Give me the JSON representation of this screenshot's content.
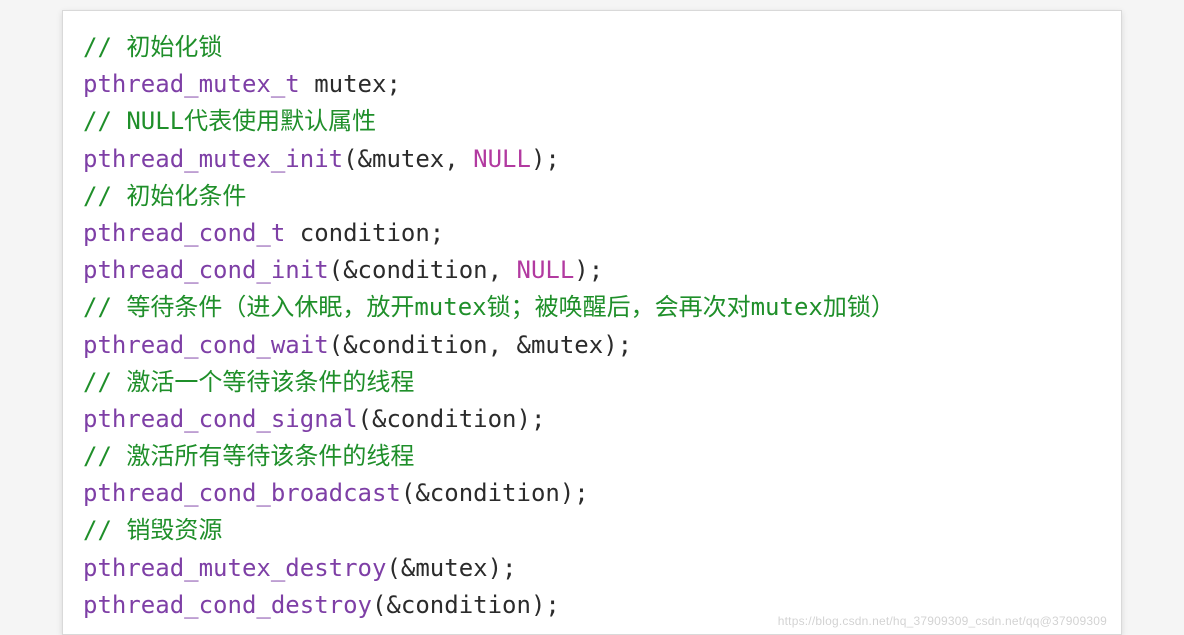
{
  "watermark": "https://blog.csdn.net/hq_37909309_csdn.net/qq@37909309",
  "code": {
    "lines": [
      {
        "tokens": [
          {
            "c": "tok-comment",
            "t": "// 初始化锁"
          }
        ]
      },
      {
        "tokens": [
          {
            "c": "tok-type",
            "t": "pthread_mutex_t"
          },
          {
            "c": "tok-ident",
            "t": " mutex"
          },
          {
            "c": "tok-punct",
            "t": ";"
          }
        ]
      },
      {
        "tokens": [
          {
            "c": "tok-comment",
            "t": "// NULL代表使用默认属性"
          }
        ]
      },
      {
        "tokens": [
          {
            "c": "tok-func",
            "t": "pthread_mutex_init"
          },
          {
            "c": "tok-punct",
            "t": "(&"
          },
          {
            "c": "tok-ident",
            "t": "mutex"
          },
          {
            "c": "tok-punct",
            "t": ", "
          },
          {
            "c": "tok-const",
            "t": "NULL"
          },
          {
            "c": "tok-punct",
            "t": ");"
          }
        ]
      },
      {
        "tokens": [
          {
            "c": "tok-comment",
            "t": "// 初始化条件"
          }
        ]
      },
      {
        "tokens": [
          {
            "c": "tok-type",
            "t": "pthread_cond_t"
          },
          {
            "c": "tok-ident",
            "t": " condition"
          },
          {
            "c": "tok-punct",
            "t": ";"
          }
        ]
      },
      {
        "tokens": [
          {
            "c": "tok-func",
            "t": "pthread_cond_init"
          },
          {
            "c": "tok-punct",
            "t": "(&"
          },
          {
            "c": "tok-ident",
            "t": "condition"
          },
          {
            "c": "tok-punct",
            "t": ", "
          },
          {
            "c": "tok-const",
            "t": "NULL"
          },
          {
            "c": "tok-punct",
            "t": ");"
          }
        ]
      },
      {
        "tokens": [
          {
            "c": "tok-comment",
            "t": "// 等待条件（进入休眠，放开mutex锁；被唤醒后，会再次对mutex加锁）"
          }
        ]
      },
      {
        "tokens": [
          {
            "c": "tok-func",
            "t": "pthread_cond_wait"
          },
          {
            "c": "tok-punct",
            "t": "(&"
          },
          {
            "c": "tok-ident",
            "t": "condition"
          },
          {
            "c": "tok-punct",
            "t": ", &"
          },
          {
            "c": "tok-ident",
            "t": "mutex"
          },
          {
            "c": "tok-punct",
            "t": ");"
          }
        ]
      },
      {
        "tokens": [
          {
            "c": "tok-comment",
            "t": "// 激活一个等待该条件的线程"
          }
        ]
      },
      {
        "tokens": [
          {
            "c": "tok-func",
            "t": "pthread_cond_signal"
          },
          {
            "c": "tok-punct",
            "t": "(&"
          },
          {
            "c": "tok-ident",
            "t": "condition"
          },
          {
            "c": "tok-punct",
            "t": ");"
          }
        ]
      },
      {
        "tokens": [
          {
            "c": "tok-comment",
            "t": "// 激活所有等待该条件的线程"
          }
        ]
      },
      {
        "tokens": [
          {
            "c": "tok-func",
            "t": "pthread_cond_broadcast"
          },
          {
            "c": "tok-punct",
            "t": "(&"
          },
          {
            "c": "tok-ident",
            "t": "condition"
          },
          {
            "c": "tok-punct",
            "t": ");"
          }
        ]
      },
      {
        "tokens": [
          {
            "c": "tok-comment",
            "t": "// 销毁资源"
          }
        ]
      },
      {
        "tokens": [
          {
            "c": "tok-func",
            "t": "pthread_mutex_destroy"
          },
          {
            "c": "tok-punct",
            "t": "(&"
          },
          {
            "c": "tok-ident",
            "t": "mutex"
          },
          {
            "c": "tok-punct",
            "t": ");"
          }
        ]
      },
      {
        "tokens": [
          {
            "c": "tok-func",
            "t": "pthread_cond_destroy"
          },
          {
            "c": "tok-punct",
            "t": "(&"
          },
          {
            "c": "tok-ident",
            "t": "condition"
          },
          {
            "c": "tok-punct",
            "t": ");"
          }
        ]
      }
    ]
  }
}
